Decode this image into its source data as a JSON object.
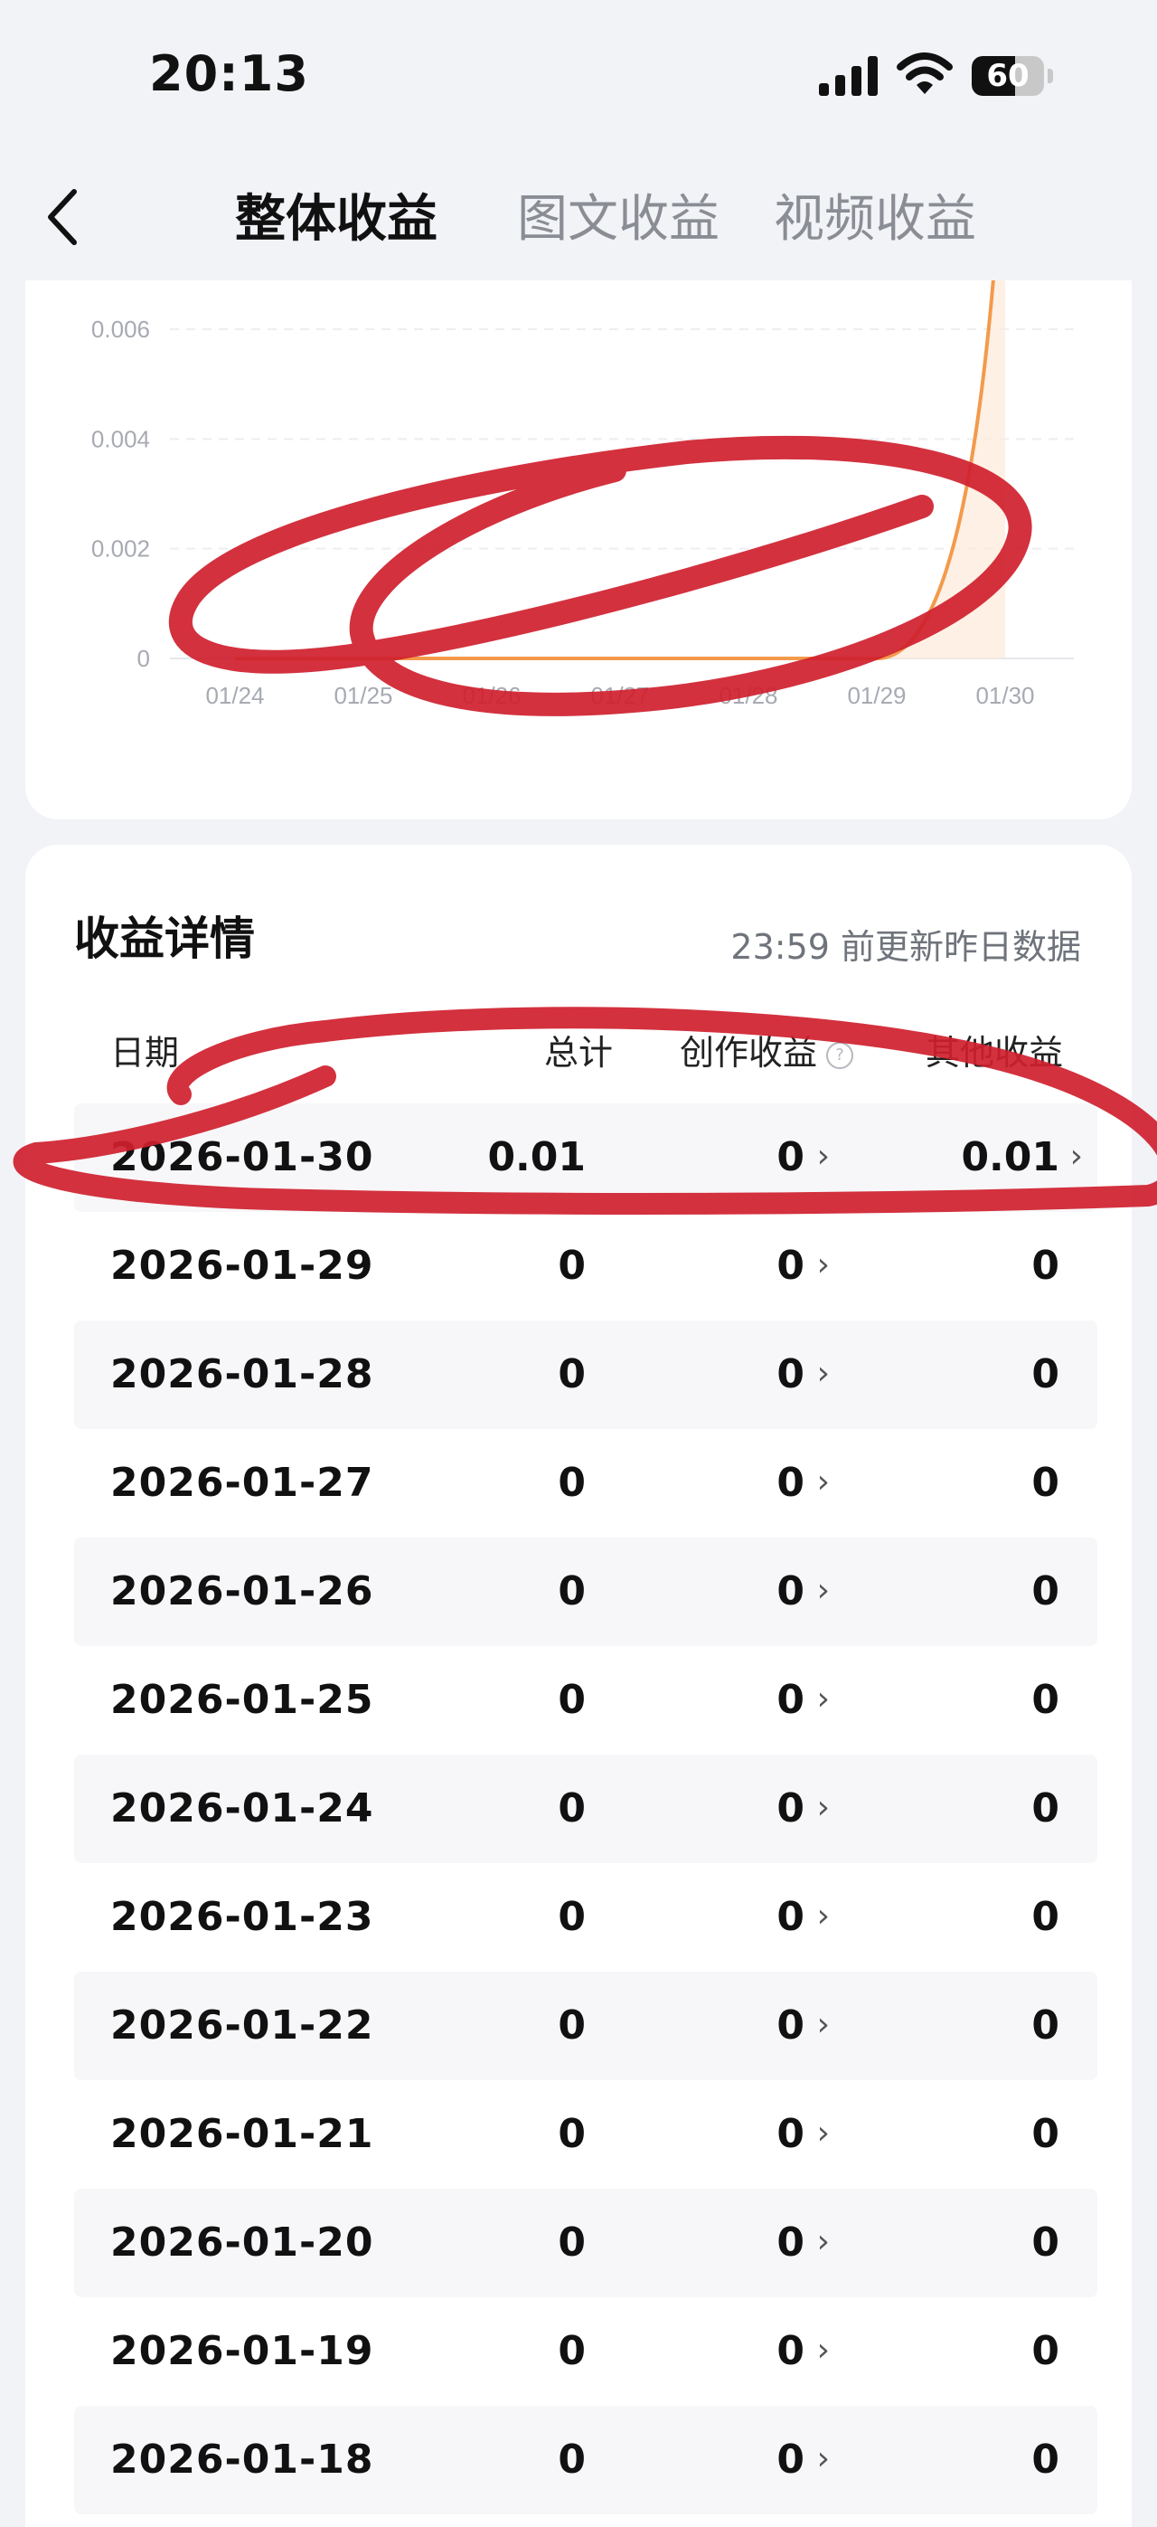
{
  "status_bar": {
    "time": "20:13",
    "battery": "60",
    "battery_level_pct": 60
  },
  "nav": {
    "tabs": [
      {
        "label": "整体收益",
        "active": true
      },
      {
        "label": "图文收益",
        "active": false
      },
      {
        "label": "视频收益",
        "active": false
      }
    ]
  },
  "chart_data": {
    "type": "area",
    "categories": [
      "01/24",
      "01/25",
      "01/26",
      "01/27",
      "01/28",
      "01/29",
      "01/30"
    ],
    "y_ticks": [
      "0.006",
      "0.004",
      "0.002",
      "0"
    ],
    "values": [
      0,
      0,
      0,
      0,
      0,
      0,
      0.01
    ],
    "ylim": [
      0,
      0.006
    ],
    "grid": true,
    "line_color": "#f39a4c",
    "area_color": "#fde9d8"
  },
  "details": {
    "title": "收益详情",
    "note": "23:59 前更新昨日数据",
    "columns": {
      "date": "日期",
      "total": "总计",
      "create": "创作收益",
      "other": "其他收益"
    },
    "rows": [
      {
        "date": "2026-01-30",
        "total": "0.01",
        "create": "0",
        "other": "0.01"
      },
      {
        "date": "2026-01-29",
        "total": "0",
        "create": "0",
        "other": "0"
      },
      {
        "date": "2026-01-28",
        "total": "0",
        "create": "0",
        "other": "0"
      },
      {
        "date": "2026-01-27",
        "total": "0",
        "create": "0",
        "other": "0"
      },
      {
        "date": "2026-01-26",
        "total": "0",
        "create": "0",
        "other": "0"
      },
      {
        "date": "2026-01-25",
        "total": "0",
        "create": "0",
        "other": "0"
      },
      {
        "date": "2026-01-24",
        "total": "0",
        "create": "0",
        "other": "0"
      },
      {
        "date": "2026-01-23",
        "total": "0",
        "create": "0",
        "other": "0"
      },
      {
        "date": "2026-01-22",
        "total": "0",
        "create": "0",
        "other": "0"
      },
      {
        "date": "2026-01-21",
        "total": "0",
        "create": "0",
        "other": "0"
      },
      {
        "date": "2026-01-20",
        "total": "0",
        "create": "0",
        "other": "0"
      },
      {
        "date": "2026-01-19",
        "total": "0",
        "create": "0",
        "other": "0"
      },
      {
        "date": "2026-01-18",
        "total": "0",
        "create": "0",
        "other": "0"
      }
    ]
  },
  "colors": {
    "annotation": "#cf1f2e",
    "accent": "#f39a4c"
  }
}
